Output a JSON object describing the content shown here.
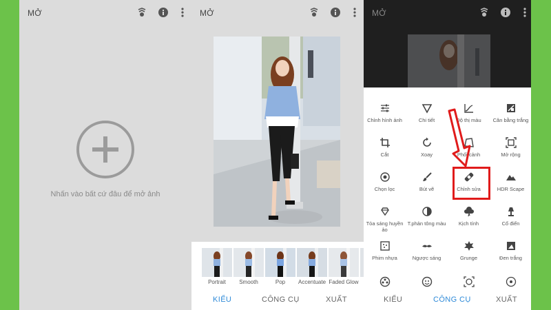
{
  "screens": {
    "empty": {
      "title": "MỞ",
      "hint": "Nhấn vào bất cứ đâu để mở ảnh"
    },
    "styles": {
      "title": "MỞ",
      "thumbnails": [
        {
          "label": "Portrait"
        },
        {
          "label": "Smooth"
        },
        {
          "label": "Pop"
        },
        {
          "label": "Accentuate"
        },
        {
          "label": "Faded Glow"
        }
      ]
    },
    "tools": {
      "title": "MỞ",
      "items": [
        {
          "label": "Chỉnh hình ảnh",
          "icon": "tune-sliders-icon"
        },
        {
          "label": "Chi tiết",
          "icon": "details-triangle-icon"
        },
        {
          "label": "Độ thị màu",
          "icon": "curves-icon"
        },
        {
          "label": "Cân bằng trắng",
          "icon": "white-balance-icon"
        },
        {
          "label": "Cắt",
          "icon": "crop-icon"
        },
        {
          "label": "Xoay",
          "icon": "rotate-icon"
        },
        {
          "label": "Phối cảnh",
          "icon": "perspective-icon"
        },
        {
          "label": "Mở rộng",
          "icon": "expand-icon"
        },
        {
          "label": "Chọn lọc",
          "icon": "selective-icon"
        },
        {
          "label": "Bút vẽ",
          "icon": "brush-icon"
        },
        {
          "label": "Chỉnh sửa",
          "icon": "healing-bandage-icon"
        },
        {
          "label": "HDR Scape",
          "icon": "mountain-icon"
        },
        {
          "label": "Tỏa sáng huyền ảo",
          "icon": "glamour-glow-icon"
        },
        {
          "label": "T.phản tông màu",
          "icon": "tonal-contrast-icon"
        },
        {
          "label": "Kịch tính",
          "icon": "drama-cloud-icon"
        },
        {
          "label": "Cổ điển",
          "icon": "vintage-lamp-icon"
        },
        {
          "label": "Phim nhựa",
          "icon": "film-grain-icon"
        },
        {
          "label": "Ngược sáng",
          "icon": "mustache-icon"
        },
        {
          "label": "Grunge",
          "icon": "grunge-icon"
        },
        {
          "label": "Đen trắng",
          "icon": "black-white-icon"
        },
        {
          "label": "",
          "icon": "film-reel-icon"
        },
        {
          "label": "",
          "icon": "face-icon"
        },
        {
          "label": "",
          "icon": "face-frame-icon"
        },
        {
          "label": "",
          "icon": "circle-dots-icon"
        }
      ]
    }
  },
  "tabs": {
    "styles": "KIỂU",
    "tools": "CÔNG CỤ",
    "export": "XUẤT"
  },
  "colors": {
    "background": "#6cc24a",
    "accent": "#2e8ad8",
    "highlight": "#e01b1b"
  }
}
